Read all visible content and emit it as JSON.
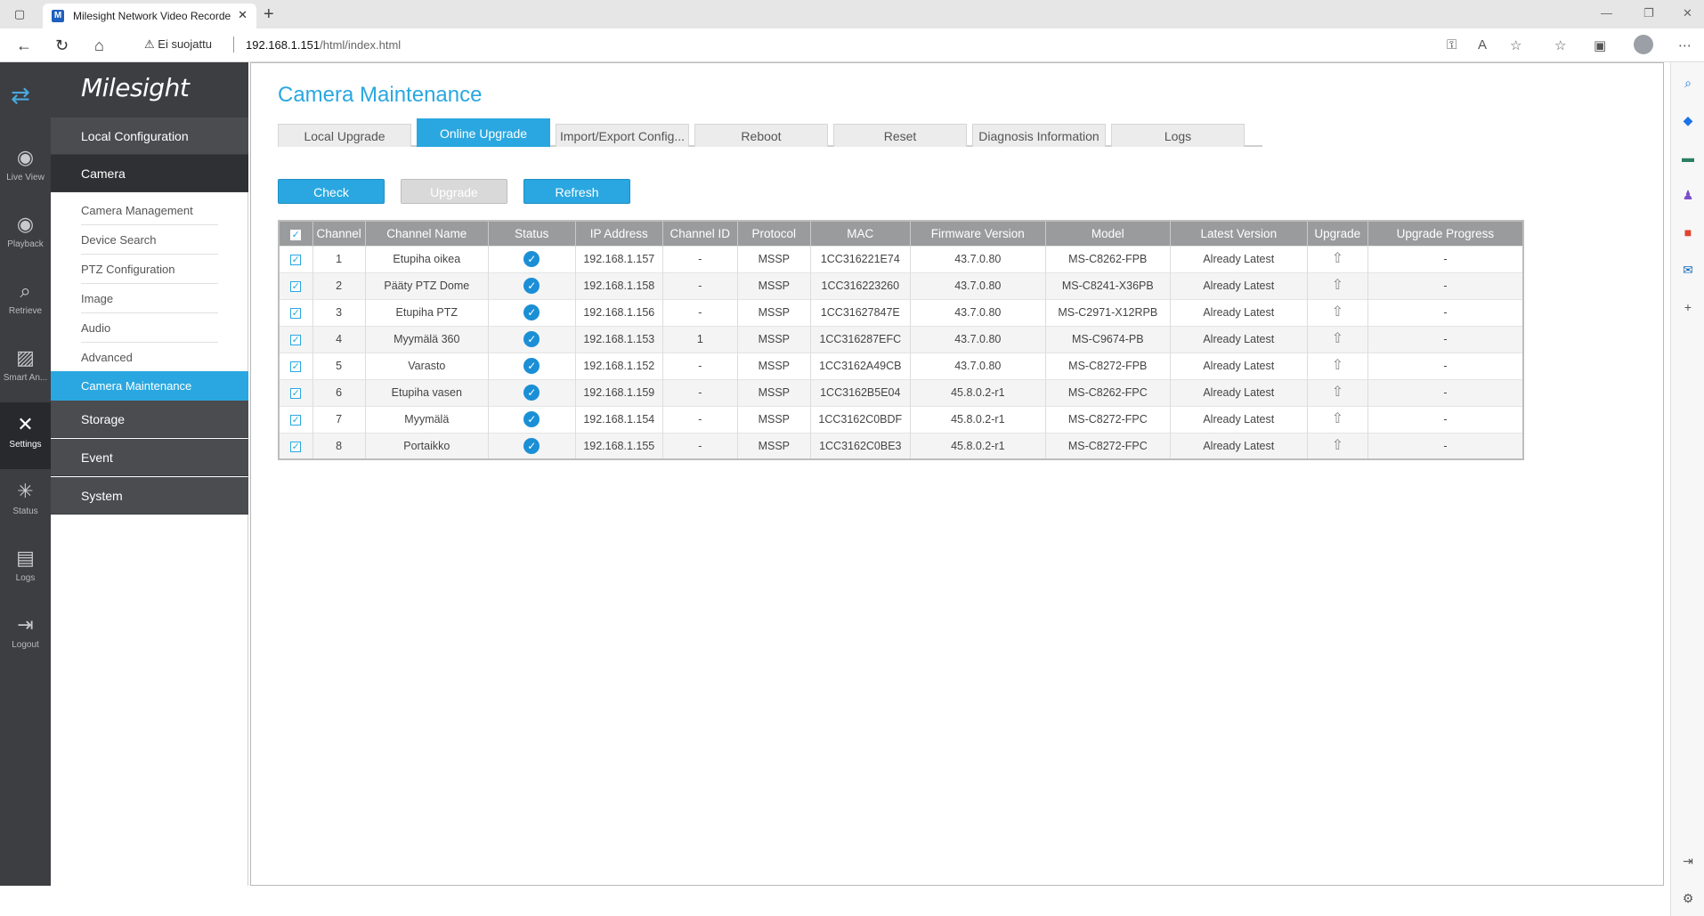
{
  "browser": {
    "tab_title": "Milesight Network Video Recorde",
    "favicon_letter": "M",
    "security_label": "Ei suojattu",
    "url_host": "192.168.1.151",
    "url_path": "/html/index.html"
  },
  "rail": {
    "items": [
      {
        "label": "Live View",
        "icon": "live-view-icon"
      },
      {
        "label": "Playback",
        "icon": "playback-icon"
      },
      {
        "label": "Retrieve",
        "icon": "retrieve-icon"
      },
      {
        "label": "Smart An...",
        "icon": "smart-analysis-icon"
      },
      {
        "label": "Settings",
        "icon": "settings-icon"
      },
      {
        "label": "Status",
        "icon": "status-icon"
      },
      {
        "label": "Logs",
        "icon": "logs-icon"
      },
      {
        "label": "Logout",
        "icon": "logout-icon"
      }
    ]
  },
  "menu": {
    "brand": "Milesight",
    "local_configuration": "Local Configuration",
    "camera": "Camera",
    "camera_subitems": [
      "Camera Management",
      "Device Search",
      "PTZ Configuration",
      "Image",
      "Audio",
      "Advanced",
      "Camera Maintenance"
    ],
    "storage": "Storage",
    "event": "Event",
    "system": "System"
  },
  "page": {
    "title": "Camera Maintenance",
    "tabs": [
      "Local Upgrade",
      "Online Upgrade",
      "Import/Export Config...",
      "Reboot",
      "Reset",
      "Diagnosis Information",
      "Logs"
    ],
    "buttons": {
      "check": "Check",
      "upgrade": "Upgrade",
      "refresh": "Refresh"
    }
  },
  "table": {
    "headers": [
      "Channel",
      "Channel Name",
      "Status",
      "IP Address",
      "Channel ID",
      "Protocol",
      "MAC",
      "Firmware Version",
      "Model",
      "Latest Version",
      "Upgrade",
      "Upgrade Progress"
    ],
    "rows": [
      {
        "channel": "1",
        "name": "Etupiha oikea",
        "ip": "192.168.1.157",
        "channel_id": "-",
        "protocol": "MSSP",
        "mac": "1CC316221E74",
        "firmware": "43.7.0.80",
        "model": "MS-C8262-FPB",
        "latest": "Already Latest",
        "progress": "-"
      },
      {
        "channel": "2",
        "name": "Pääty PTZ Dome",
        "ip": "192.168.1.158",
        "channel_id": "-",
        "protocol": "MSSP",
        "mac": "1CC316223260",
        "firmware": "43.7.0.80",
        "model": "MS-C8241-X36PB",
        "latest": "Already Latest",
        "progress": "-"
      },
      {
        "channel": "3",
        "name": "Etupiha PTZ",
        "ip": "192.168.1.156",
        "channel_id": "-",
        "protocol": "MSSP",
        "mac": "1CC31627847E",
        "firmware": "43.7.0.80",
        "model": "MS-C2971-X12RPB",
        "latest": "Already Latest",
        "progress": "-"
      },
      {
        "channel": "4",
        "name": "Myymälä 360",
        "ip": "192.168.1.153",
        "channel_id": "1",
        "protocol": "MSSP",
        "mac": "1CC316287EFC",
        "firmware": "43.7.0.80",
        "model": "MS-C9674-PB",
        "latest": "Already Latest",
        "progress": "-"
      },
      {
        "channel": "5",
        "name": "Varasto",
        "ip": "192.168.1.152",
        "channel_id": "-",
        "protocol": "MSSP",
        "mac": "1CC3162A49CB",
        "firmware": "43.7.0.80",
        "model": "MS-C8272-FPB",
        "latest": "Already Latest",
        "progress": "-"
      },
      {
        "channel": "6",
        "name": "Etupiha vasen",
        "ip": "192.168.1.159",
        "channel_id": "-",
        "protocol": "MSSP",
        "mac": "1CC3162B5E04",
        "firmware": "45.8.0.2-r1",
        "model": "MS-C8262-FPC",
        "latest": "Already Latest",
        "progress": "-"
      },
      {
        "channel": "7",
        "name": "Myymälä",
        "ip": "192.168.1.154",
        "channel_id": "-",
        "protocol": "MSSP",
        "mac": "1CC3162C0BDF",
        "firmware": "45.8.0.2-r1",
        "model": "MS-C8272-FPC",
        "latest": "Already Latest",
        "progress": "-"
      },
      {
        "channel": "8",
        "name": "Portaikko",
        "ip": "192.168.1.155",
        "channel_id": "-",
        "protocol": "MSSP",
        "mac": "1CC3162C0BE3",
        "firmware": "45.8.0.2-r1",
        "model": "MS-C8272-FPC",
        "latest": "Already Latest",
        "progress": "-"
      }
    ]
  },
  "colors": {
    "accent": "#2aa7e0",
    "rail_bg": "#3c3e42",
    "header_gray": "#999b9d"
  }
}
